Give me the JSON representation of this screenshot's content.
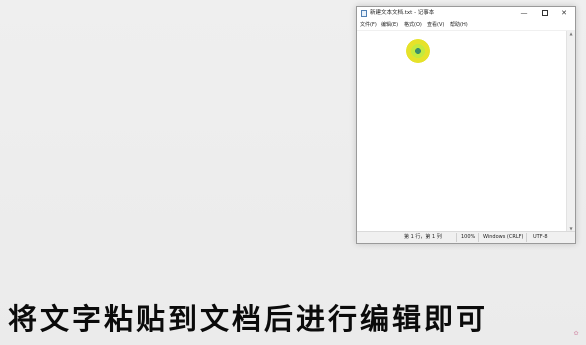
{
  "notepad": {
    "title": "新建文本文档.txt - 记事本",
    "buttons": {
      "minimize": "—",
      "close": "✕"
    },
    "menu": [
      "文件(F)",
      "编辑(E)",
      "格式(O)",
      "查看(V)",
      "帮助(H)"
    ],
    "editor_text": "",
    "status": {
      "position": "第 1 行，第 1 列",
      "zoom": "100%",
      "line_ending": "Windows (CRLF)",
      "encoding": "UTF-8"
    }
  },
  "caption": "将文字粘贴到文档后进行编辑即可",
  "icons": {
    "app": "notepad-icon",
    "cursor": "cursor-highlight-icon",
    "watermark": "watermark-logo-icon"
  },
  "colors": {
    "cursor_outer": "#e6e22a",
    "cursor_inner": "#3d8f6a",
    "caption": "#0b0b0b"
  }
}
